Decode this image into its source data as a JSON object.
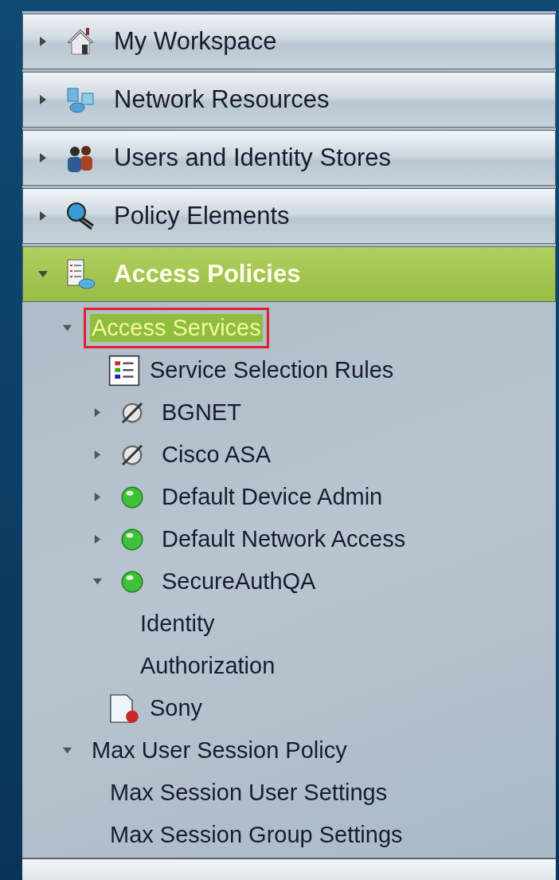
{
  "headers": [
    {
      "label": "My Workspace",
      "kind": "house",
      "expanded": false,
      "selected": false
    },
    {
      "label": "Network Resources",
      "kind": "network",
      "expanded": false,
      "selected": false
    },
    {
      "label": "Users and Identity Stores",
      "kind": "users",
      "expanded": false,
      "selected": false
    },
    {
      "label": "Policy Elements",
      "kind": "policy",
      "expanded": false,
      "selected": false
    },
    {
      "label": "Access Policies",
      "kind": "clipboard",
      "expanded": true,
      "selected": true
    }
  ],
  "tree": [
    {
      "label": "Access Services",
      "expanded": true,
      "selected": true,
      "outlined": true,
      "children": [
        {
          "label": "Service Selection Rules",
          "kind": "rules",
          "selected": false
        },
        {
          "label": "BGNET",
          "kind": "service",
          "enabled": false,
          "expanded": false,
          "selected": false
        },
        {
          "label": "Cisco ASA",
          "kind": "service",
          "enabled": false,
          "expanded": false,
          "selected": false
        },
        {
          "label": "Default Device Admin",
          "kind": "service",
          "enabled": true,
          "expanded": false,
          "selected": false
        },
        {
          "label": "Default Network Access",
          "kind": "service",
          "enabled": true,
          "expanded": false,
          "selected": false
        },
        {
          "label": "SecureAuthQA",
          "kind": "service",
          "enabled": true,
          "expanded": true,
          "selected": false,
          "children": [
            {
              "label": "Identity",
              "selected": false
            },
            {
              "label": "Authorization",
              "selected": false
            }
          ]
        },
        {
          "label": "Sony",
          "kind": "document",
          "selected": false
        }
      ]
    },
    {
      "label": "Max User Session Policy",
      "expanded": true,
      "selected": false,
      "children": [
        {
          "label": "Max Session User Settings",
          "selected": false
        },
        {
          "label": "Max Session Group Settings",
          "selected": false
        }
      ]
    }
  ]
}
